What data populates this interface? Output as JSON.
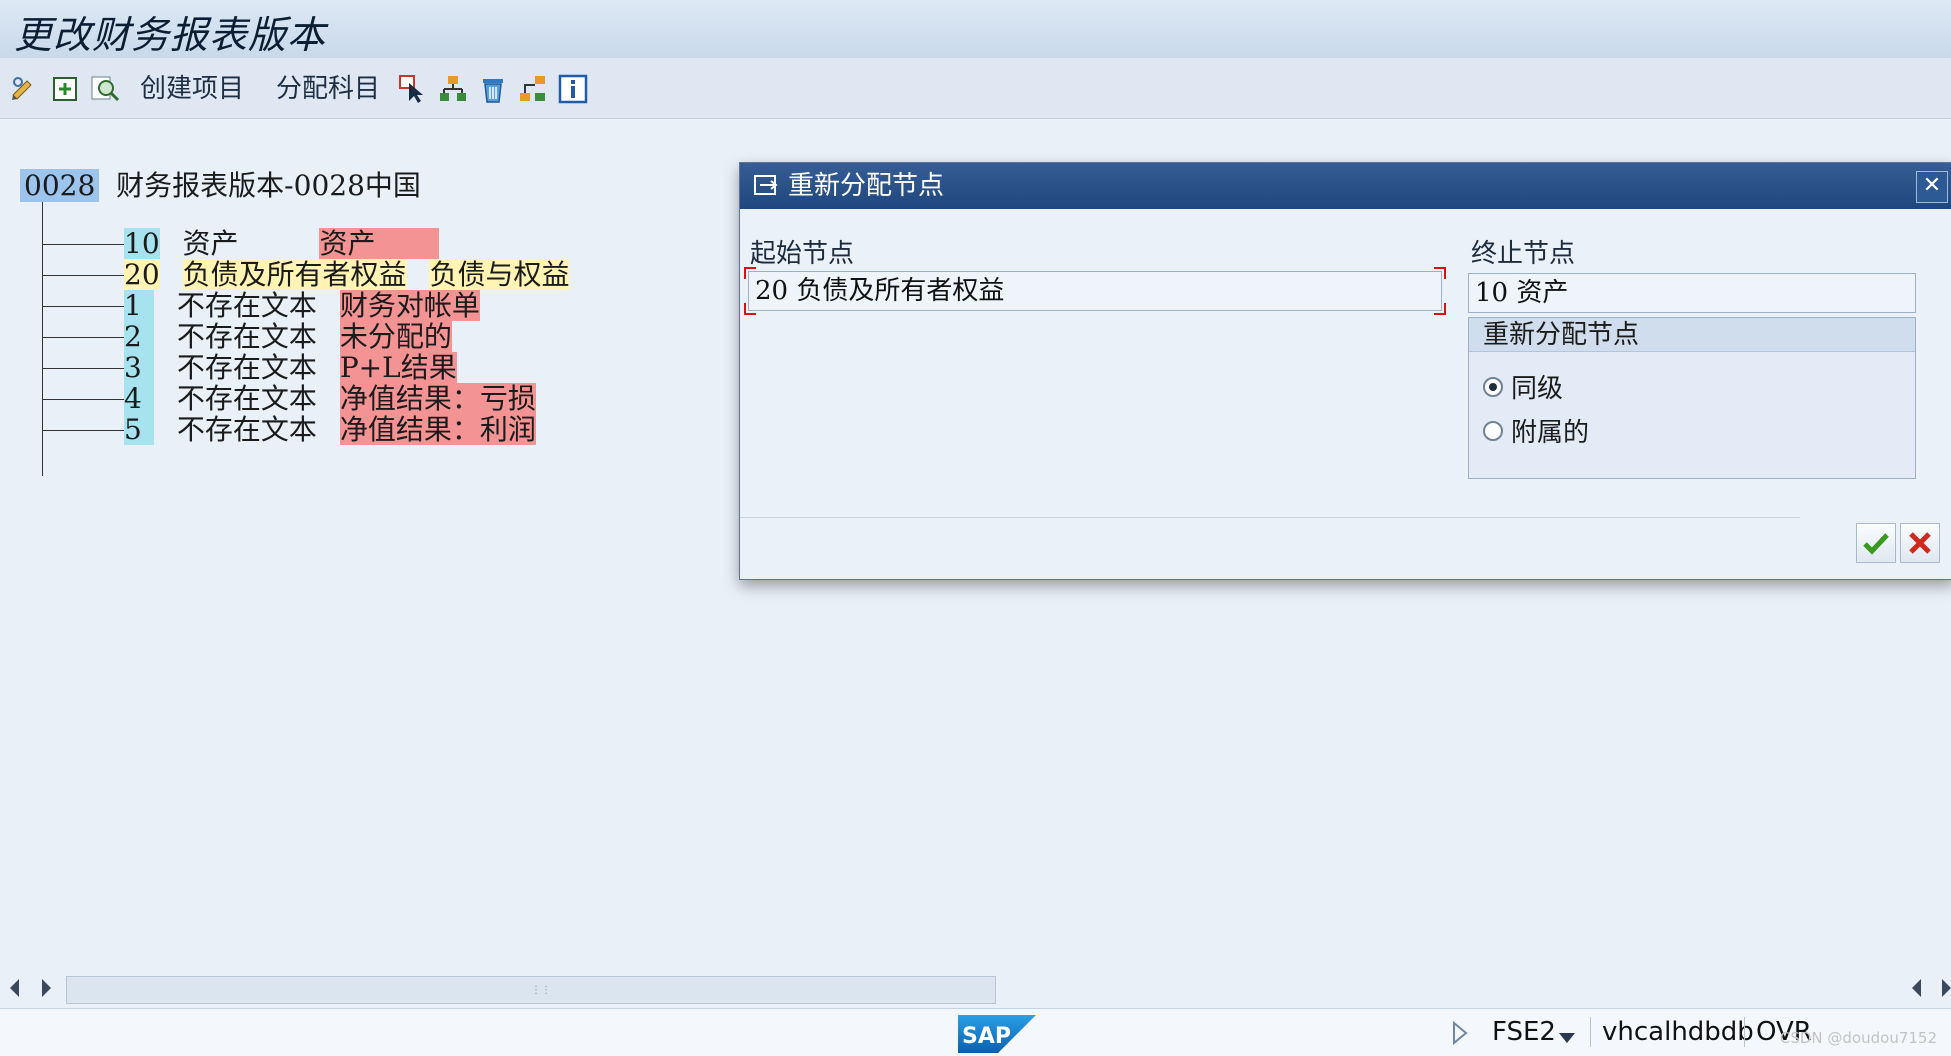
{
  "window": {
    "title": "更改财务报表版本"
  },
  "toolbar": {
    "create_item_label": "创建项目",
    "assign_accounts_label": "分配科目"
  },
  "tree": {
    "root_code": "0028",
    "root_label": "财务报表版本-0028中国",
    "nodes": [
      {
        "code": "10",
        "text": "资产",
        "desc": "资产"
      },
      {
        "code": "20",
        "text": "负债及所有者权益",
        "desc": "负债与权益"
      },
      {
        "code": "1",
        "text": "不存在文本",
        "desc": "财务对帐单"
      },
      {
        "code": "2",
        "text": "不存在文本",
        "desc": "未分配的"
      },
      {
        "code": "3",
        "text": "不存在文本",
        "desc": "P+L结果"
      },
      {
        "code": "4",
        "text": "不存在文本",
        "desc": "净值结果：亏损"
      },
      {
        "code": "5",
        "text": "不存在文本",
        "desc": "净值结果：利润"
      }
    ]
  },
  "dialog": {
    "title": "重新分配节点",
    "start_node_label": "起始节点",
    "start_node_value": "20 负债及所有者权益",
    "end_node_label": "终止节点",
    "end_node_value": "10 资产",
    "group_title": "重新分配节点",
    "radio_same_level": "同级",
    "radio_subordinate": "附属的",
    "selected": "same_level"
  },
  "status": {
    "transaction": "FSE2",
    "server": "vhcalhdbdb",
    "mode": "OVR",
    "watermark": "CSDN @doudou7152"
  },
  "colors": {
    "title_bar": "#c9d9ea",
    "dialog_header": "#1f477f",
    "highlight_cyan": "#a6e3ef",
    "highlight_yellow": "#fff4b3",
    "highlight_red": "#f49393"
  }
}
